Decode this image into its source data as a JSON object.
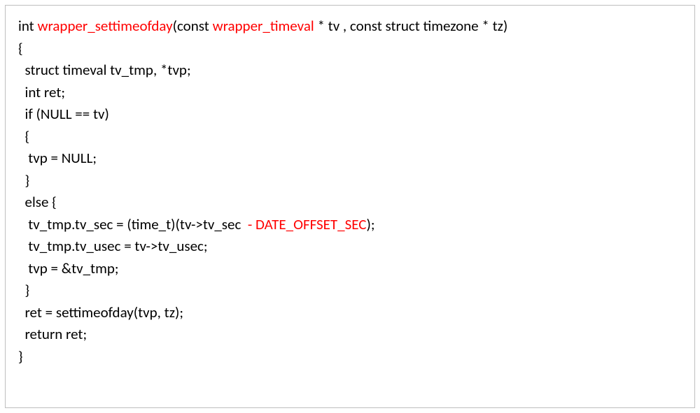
{
  "code": {
    "l1_a": "int ",
    "l1_b": "wrapper_settimeofday",
    "l1_c": "(const ",
    "l1_d": "wrapper_timeval",
    "l1_e": " * tv , const struct timezone * tz)",
    "l2": "{",
    "l3": "  struct timeval tv_tmp, *tvp;",
    "l4": "  int ret;",
    "l5": "  if (NULL == tv)",
    "l6": "  {",
    "l7": "   tvp = NULL;",
    "l8": "  }",
    "l9": "  else {",
    "l10_a": "   tv_tmp.tv_sec = (time_t)(tv->tv_sec ",
    "l10_b": " - DATE_OFFSET_SEC",
    "l10_c": ");",
    "l11": "   tv_tmp.tv_usec = tv->tv_usec;",
    "l12": "   tvp = &tv_tmp;",
    "l13": "  }",
    "l14": "  ret = settimeofday(tvp, tz);",
    "l15": "  return ret;",
    "l16": "}"
  }
}
